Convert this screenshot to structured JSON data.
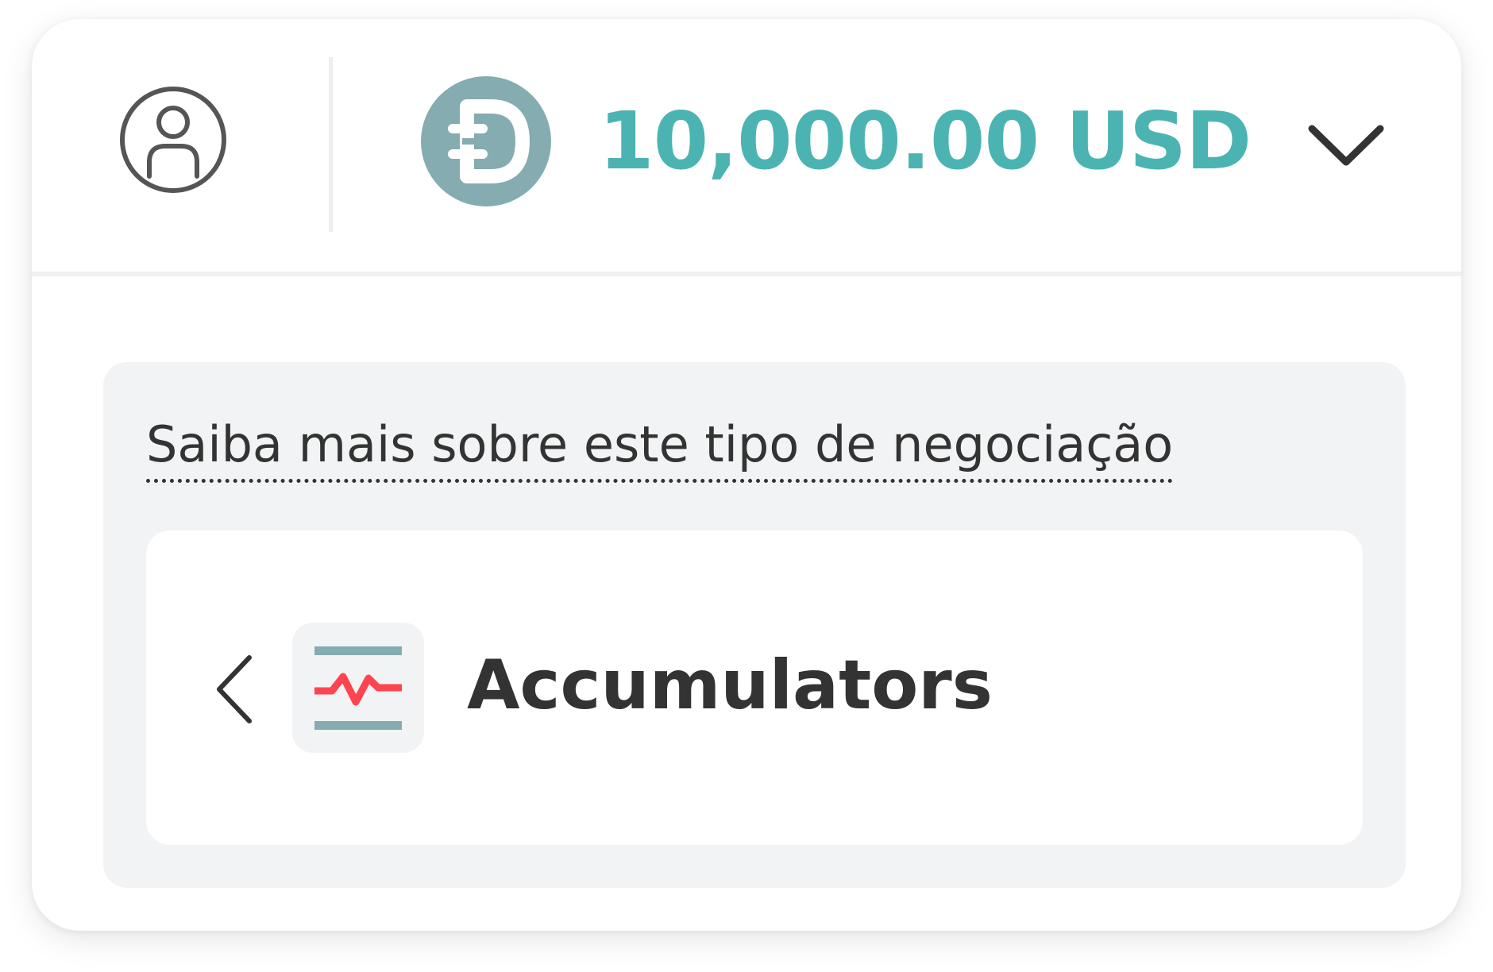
{
  "header": {
    "account_icon": "user-circle-icon",
    "currency_icon": "deriv-demo-currency-icon",
    "balance": "10,000.00 USD",
    "dropdown_icon": "chevron-down-icon"
  },
  "learn_more": {
    "text": "Saiba mais sobre este tipo de negociação"
  },
  "trade_type": {
    "back_icon": "chevron-left-icon",
    "icon": "accumulators-icon",
    "name": "Accumulators"
  },
  "colors": {
    "balance": "#4bb4b3",
    "currency_icon_bg": "#85acb0",
    "accumulator_line": "#85acb0",
    "accumulator_signal": "#ff444f",
    "panel_bg": "#f2f3f4",
    "text": "#333333"
  }
}
